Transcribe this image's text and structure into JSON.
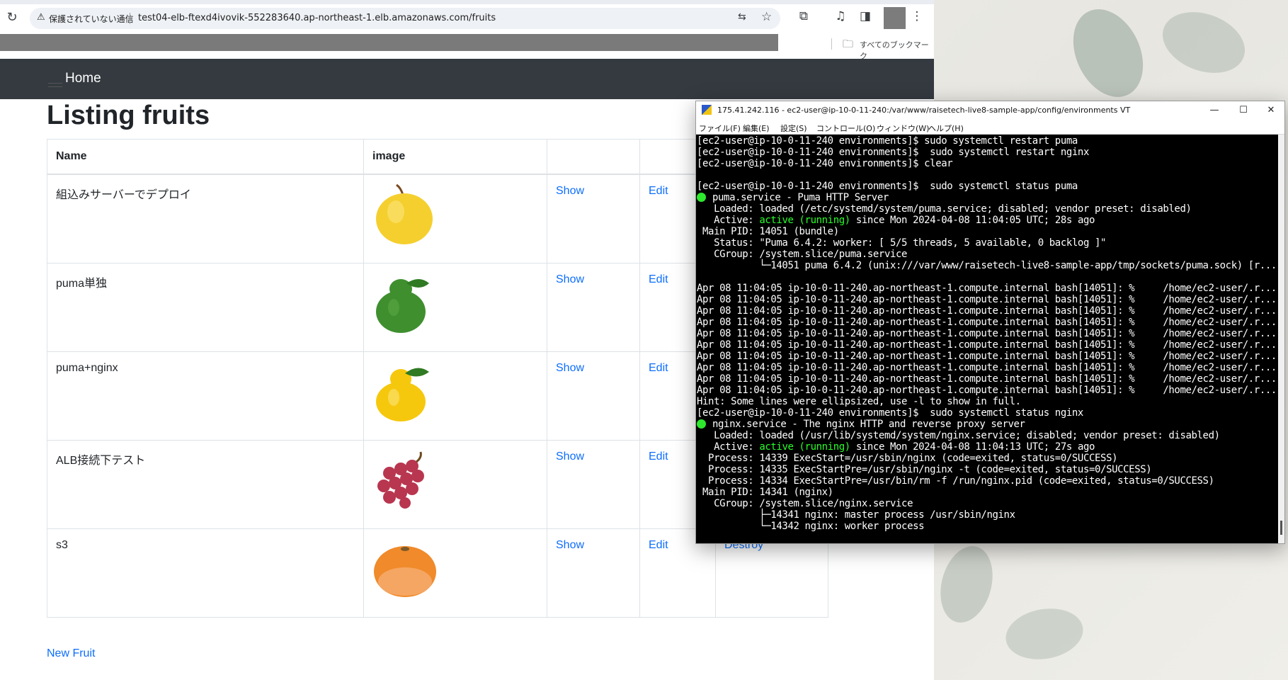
{
  "browser": {
    "security_label": "保護されていない通信",
    "url": "test04-elb-ftexd4ivovik-552283640.ap-northeast-1.elb.amazonaws.com/fruits",
    "all_bookmarks_label": "すべてのブックマーク"
  },
  "page": {
    "nav_home": "Home",
    "title": "Listing fruits",
    "table": {
      "headers": [
        "Name",
        "image",
        "",
        "",
        ""
      ],
      "rows": [
        {
          "name": "組込みサーバーでデプロイ",
          "fruit": "yellow-pear",
          "show": "Show",
          "edit": "Edit",
          "destroy": ""
        },
        {
          "name": "puma単独",
          "fruit": "green-citrus",
          "show": "Show",
          "edit": "Edit",
          "destroy": ""
        },
        {
          "name": "puma+nginx",
          "fruit": "yellow-yuzu",
          "show": "Show",
          "edit": "Edit",
          "destroy": ""
        },
        {
          "name": "ALB接続下テスト",
          "fruit": "grapes",
          "show": "Show",
          "edit": "Edit",
          "destroy": ""
        },
        {
          "name": "s3",
          "fruit": "orange",
          "show": "Show",
          "edit": "Edit",
          "destroy": "Destroy"
        }
      ]
    },
    "new_link": "New Fruit",
    "link_color": "#0d6efd",
    "navbar_color": "#343a40"
  },
  "terminal": {
    "title": "175.41.242.116 - ec2-user@ip-10-0-11-240:/var/www/raisetech-live8-sample-app/config/environments VT",
    "menu": [
      "ファイル(F)",
      "編集(E)",
      "設定(S)",
      "コントロール(O)",
      "ウィンドウ(W)",
      "ヘルプ(H)"
    ],
    "lines": [
      {
        "text": "[ec2-user@ip-10-0-11-240 environments]$ sudo systemctl restart puma"
      },
      {
        "text": "[ec2-user@ip-10-0-11-240 environments]$  sudo systemctl restart nginx"
      },
      {
        "text": "[ec2-user@ip-10-0-11-240 environments]$ clear"
      },
      {
        "text": ""
      },
      {
        "text": "[ec2-user@ip-10-0-11-240 environments]$  sudo systemctl status puma"
      },
      {
        "dot": true,
        "text": "puma.service - Puma HTTP Server"
      },
      {
        "text": "   Loaded: loaded (/etc/systemd/system/puma.service; disabled; vendor preset: disabled)"
      },
      {
        "text": "   Active: ",
        "green": "active (running)",
        "rest": " since Mon 2024-04-08 11:04:05 UTC; 28s ago"
      },
      {
        "text": " Main PID: 14051 (bundle)"
      },
      {
        "text": "   Status: \"Puma 6.4.2: worker: [ 5/5 threads, 5 available, 0 backlog ]\""
      },
      {
        "text": "   CGroup: /system.slice/puma.service"
      },
      {
        "text": "           └─14051 puma 6.4.2 (unix:///var/www/raisetech-live8-sample-app/tmp/sockets/puma.sock) [r..."
      },
      {
        "text": ""
      },
      {
        "text": "Apr 08 11:04:05 ip-10-0-11-240.ap-northeast-1.compute.internal bash[14051]: %     /home/ec2-user/.r..."
      },
      {
        "text": "Apr 08 11:04:05 ip-10-0-11-240.ap-northeast-1.compute.internal bash[14051]: %     /home/ec2-user/.r..."
      },
      {
        "text": "Apr 08 11:04:05 ip-10-0-11-240.ap-northeast-1.compute.internal bash[14051]: %     /home/ec2-user/.r..."
      },
      {
        "text": "Apr 08 11:04:05 ip-10-0-11-240.ap-northeast-1.compute.internal bash[14051]: %     /home/ec2-user/.r..."
      },
      {
        "text": "Apr 08 11:04:05 ip-10-0-11-240.ap-northeast-1.compute.internal bash[14051]: %     /home/ec2-user/.r..."
      },
      {
        "text": "Apr 08 11:04:05 ip-10-0-11-240.ap-northeast-1.compute.internal bash[14051]: %     /home/ec2-user/.r..."
      },
      {
        "text": "Apr 08 11:04:05 ip-10-0-11-240.ap-northeast-1.compute.internal bash[14051]: %     /home/ec2-user/.r..."
      },
      {
        "text": "Apr 08 11:04:05 ip-10-0-11-240.ap-northeast-1.compute.internal bash[14051]: %     /home/ec2-user/.r..."
      },
      {
        "text": "Apr 08 11:04:05 ip-10-0-11-240.ap-northeast-1.compute.internal bash[14051]: %     /home/ec2-user/.r..."
      },
      {
        "text": "Apr 08 11:04:05 ip-10-0-11-240.ap-northeast-1.compute.internal bash[14051]: %     /home/ec2-user/.r..."
      },
      {
        "text": "Hint: Some lines were ellipsized, use -l to show in full."
      },
      {
        "text": "[ec2-user@ip-10-0-11-240 environments]$  sudo systemctl status nginx"
      },
      {
        "dot": true,
        "text": "nginx.service - The nginx HTTP and reverse proxy server"
      },
      {
        "text": "   Loaded: loaded (/usr/lib/systemd/system/nginx.service; disabled; vendor preset: disabled)"
      },
      {
        "text": "   Active: ",
        "green": "active (running)",
        "rest": " since Mon 2024-04-08 11:04:13 UTC; 27s ago"
      },
      {
        "text": "  Process: 14339 ExecStart=/usr/sbin/nginx (code=exited, status=0/SUCCESS)"
      },
      {
        "text": "  Process: 14335 ExecStartPre=/usr/sbin/nginx -t (code=exited, status=0/SUCCESS)"
      },
      {
        "text": "  Process: 14334 ExecStartPre=/usr/bin/rm -f /run/nginx.pid (code=exited, status=0/SUCCESS)"
      },
      {
        "text": " Main PID: 14341 (nginx)"
      },
      {
        "text": "   CGroup: /system.slice/nginx.service"
      },
      {
        "text": "           ├─14341 nginx: master process /usr/sbin/nginx"
      },
      {
        "text": "           └─14342 nginx: worker process"
      }
    ],
    "active_color": "#27ff27"
  }
}
